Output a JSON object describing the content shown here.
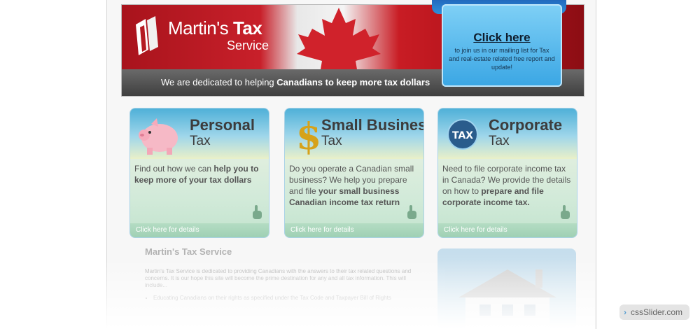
{
  "header": {
    "logo_name": "Martin's",
    "logo_name_bold": "Tax",
    "logo_sub": "Service",
    "tagline_pre": "We are dedicated to helping",
    "tagline_bold": "Canadians to keep more tax dollars"
  },
  "mailing": {
    "title": "Click here",
    "text": "to join us in our mailing list for Tax and real-estate related free report and update!"
  },
  "cards": [
    {
      "title": "Personal",
      "sub": "Tax",
      "icon": "piggy-bank-icon",
      "body_pre": "Find out how we can",
      "body_bold": "help you to keep more of your tax dollars",
      "body_post": "",
      "footer": "Click here for details"
    },
    {
      "title": "Small Business",
      "sub": "Tax",
      "icon": "dollar-sign-icon",
      "body_pre": "Do you operate a Canadian small business? We help you prepare and file",
      "body_bold": "your small business Canadian income tax return",
      "body_post": "",
      "footer": "Click here for details"
    },
    {
      "title": "Corporate",
      "sub": "Tax",
      "icon": "tax-globe-icon",
      "body_pre": "Need to file corporate income tax in Canada? We provide the details on how to",
      "body_bold": "prepare and file corporate income tax.",
      "body_post": "",
      "footer": "Click here for details"
    }
  ],
  "service": {
    "heading": "Martin's Tax Service",
    "paragraph": "Martin's Tax Service is dedicated to providing Canadians with the answers to their tax related questions and concerns. It is our hope this site will become the prime destination for any and all tax information. This will include...",
    "bullets": [
      "Educating Canadians on their rights as specified under the Tax Code and Taxpayer Bill of Rights"
    ]
  },
  "watermark": {
    "label": "cssSlider.com"
  },
  "colors": {
    "banner_red": "#c8202a",
    "mail_blue": "#3aa6e4",
    "card_border": "#a9d2e6",
    "footer_green": "#9fd0b4"
  }
}
